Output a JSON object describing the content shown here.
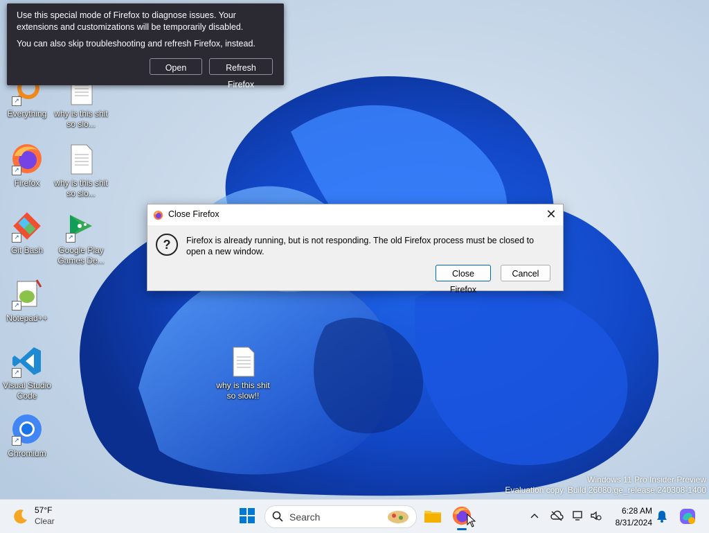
{
  "desktop": {
    "icons": [
      {
        "label": "Everything"
      },
      {
        "label": "why is this shit so slo..."
      },
      {
        "label": "Firefox"
      },
      {
        "label": "why is this shit so slo..."
      },
      {
        "label": "Git Bash"
      },
      {
        "label": "Google Play Games De..."
      },
      {
        "label": "Notepad++"
      },
      {
        "label": "Visual Studio Code"
      },
      {
        "label": "Chromium"
      },
      {
        "label": "why is this shit so slow!!"
      }
    ]
  },
  "troubleshoot": {
    "line1": "Use this special mode of Firefox to diagnose issues. Your extensions and customizations will be temporarily disabled.",
    "line2": "You can also skip troubleshooting and refresh Firefox, instead.",
    "open_label": "Open",
    "refresh_label": "Refresh Firefox"
  },
  "dialog": {
    "title": "Close Firefox",
    "message": "Firefox is already running, but is not responding. The old Firefox process must be closed to open a new window.",
    "close_label": "Close Firefox",
    "cancel_label": "Cancel"
  },
  "watermark": {
    "line1": "Windows 11 Pro Insider Preview",
    "line2": "Evaluation copy. Build 26080.ge_release.240308-1400"
  },
  "taskbar": {
    "weather_temp": "57°F",
    "weather_cond": "Clear",
    "search_placeholder": "Search",
    "time": "6:28 AM",
    "date": "8/31/2024"
  },
  "colors": {
    "accent": "#0067c0",
    "panel_bg": "#2b2a33",
    "taskbar_bg": "#eef1f6"
  }
}
